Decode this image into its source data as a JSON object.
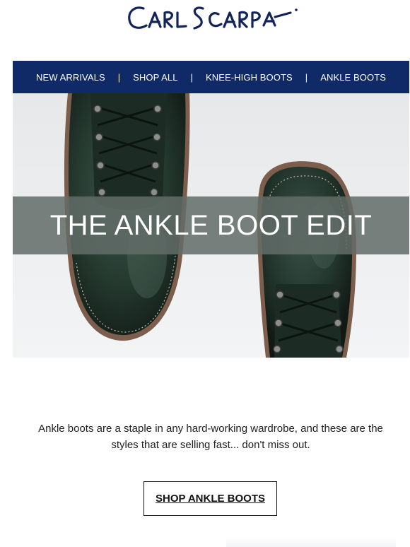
{
  "brand": {
    "logo_text": "Carl Scarpa"
  },
  "nav": {
    "items": [
      {
        "label": "NEW ARRIVALS"
      },
      {
        "label": "SHOP ALL"
      },
      {
        "label": "KNEE-HIGH BOOTS"
      },
      {
        "label": "ANKLE BOOTS"
      }
    ],
    "separator": "|",
    "background": "#0f2a66"
  },
  "hero": {
    "title": "THE ANKLE BOOT EDIT",
    "image": "dark-green-leather-lace-up-ankle-boots"
  },
  "intro": {
    "text": "Ankle boots are a staple in any hard-working wardrobe, and these are the styles that are selling fast... don't miss out."
  },
  "cta": {
    "label": "SHOP ANKLE BOOTS"
  },
  "colors": {
    "brand_navy": "#0f2a66",
    "boot_green": "#24372f"
  }
}
